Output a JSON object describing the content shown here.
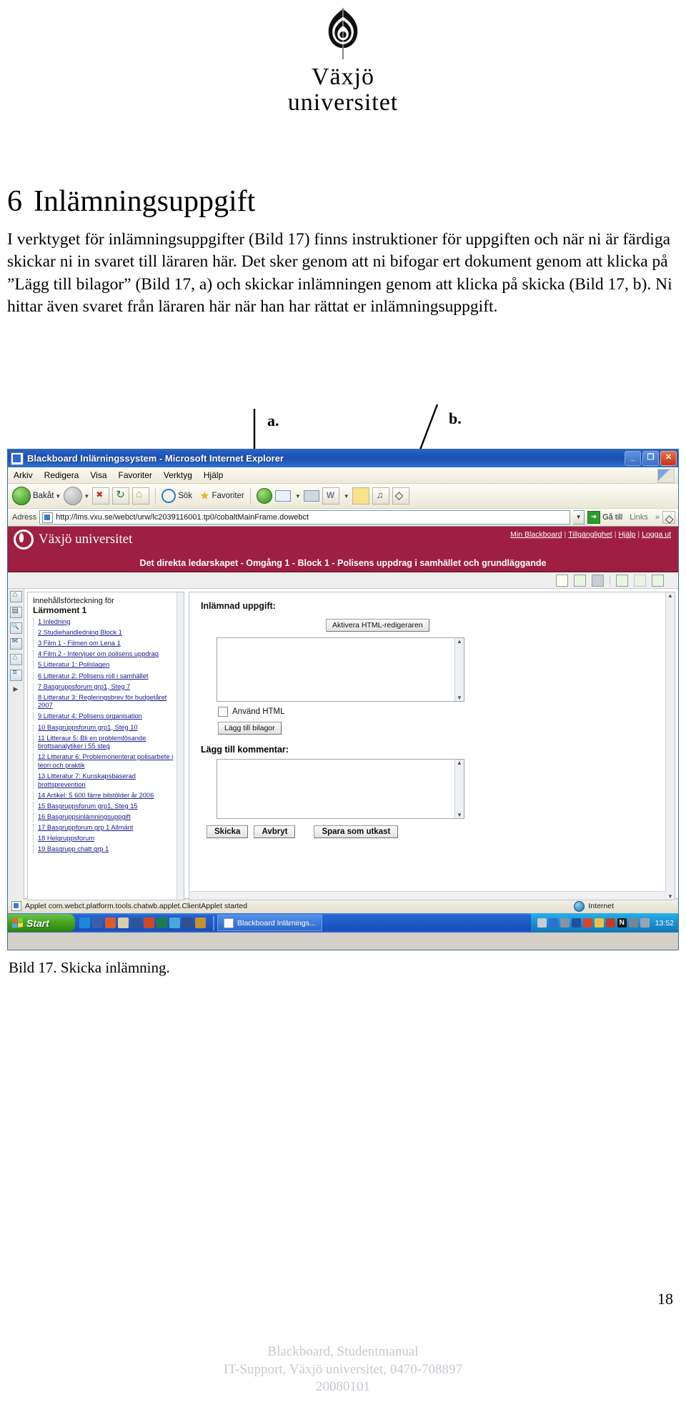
{
  "logo": {
    "icon": "vaxjo-flame-logo",
    "line1": "Växjö",
    "line2": "universitet"
  },
  "document": {
    "chapter_number": "6",
    "chapter_title": "Inlämningsuppgift",
    "paragraph": "I verktyget för inlämningsuppgifter (Bild 17) finns instruktioner för uppgiften och när ni är färdiga skickar ni in svaret till läraren här. Det sker genom att ni bifogar ert dokument genom att klicka på ”Lägg till bilagor” (Bild 17, a) och skickar inlämningen genom att klicka på skicka (Bild 17, b). Ni hittar även svaret från läraren här när han har rättat er inlämningsuppgift.",
    "callout_a": "a.",
    "callout_b": "b.",
    "figure_caption": "Bild 17. Skicka inlämning.",
    "page_number": "18",
    "footer_line1": "Blackboard, Studentmanual",
    "footer_line2": "IT-Support, Växjö universitet, 0470-708897",
    "footer_line3": "20080101"
  },
  "browser": {
    "window_title": "Blackboard Inlärningssystem - Microsoft Internet Explorer",
    "window_buttons": {
      "minimize": "_",
      "restore": "❐",
      "close": "✕"
    },
    "menu": [
      "Arkiv",
      "Redigera",
      "Visa",
      "Favoriter",
      "Verktyg",
      "Hjälp"
    ],
    "toolbar": {
      "back": "Bakåt",
      "search": "Sök",
      "favorites": "Favoriter"
    },
    "address": {
      "label": "Adress",
      "url": "http://lms.vxu.se/webct/urw/lc2039116001.tp0/cobaltMainFrame.dowebct",
      "go": "Gå till",
      "links": "Links"
    },
    "status": {
      "message": "Applet com.webct.platform.tools.chatwb.applet.ClientApplet started",
      "zone": "Internet"
    }
  },
  "blackboard": {
    "brand": "Växjö universitet",
    "top_links": [
      "Min Blackboard",
      "Tillgänglighet",
      "Hjälp",
      "Logga ut"
    ],
    "course_title": "Det direkta ledarskapet - Omgång 1 - Block 1 - Polisens uppdrag i samhället och grundläggande",
    "toc": {
      "heading_line1": "Innehållsförteckning för",
      "heading_line2": "Lärmoment 1",
      "items": [
        "1 Inledning",
        "2 Studiehandledning Block 1",
        "3 Film 1 - Filmen om Lena 1",
        "4 Film 2 - Intervjuer om polisens uppdrag",
        "5 Litteratur 1: Polislagen",
        "6 Litteratur 2: Polisens roll i samhället",
        "7 Basgruppsforum grp1, Steg 7",
        "8 Litteratur 3: Regleringsbrev för budgetåret 2007",
        "9 Litteratur 4: Polisens organisation",
        "10 Basgruppsforum grp1, Steg 10",
        "11 Litteraur 5: Bli en problemlösande brottsanalytiker i 55 steg",
        "12 Litteratur 6: Problemorienterat polisarbete i teori och praktik",
        "13 Litteratur 7: Kunskapsbaserad brottsprevention",
        "14 Artikel: 5 600 färre bilstölder år 2006",
        "15 Basgruppsforum grp1, Steg 15",
        "16 Basgruppsinlämningsuppgift",
        "17 Basgruppforum grp 1 Allmänt",
        "18 Helgruppsforum",
        "19 Basgrupp chatt grp 1"
      ]
    },
    "assignment": {
      "submitted_label": "Inlämnad uppgift:",
      "html_editor_button": "Aktivera HTML-redigeraren",
      "answer_text": "",
      "use_html_checkbox_label": "Använd HTML",
      "use_html_checked": false,
      "attach_button": "Lägg till bilagor",
      "comment_label": "Lägg till kommentar:",
      "comment_text": "",
      "submit_button": "Skicka",
      "cancel_button": "Avbryt",
      "draft_button": "Spara som utkast"
    }
  },
  "taskbar": {
    "start": "Start",
    "window_button": "Blackboard Inlärnings...",
    "clock": "13:52"
  }
}
